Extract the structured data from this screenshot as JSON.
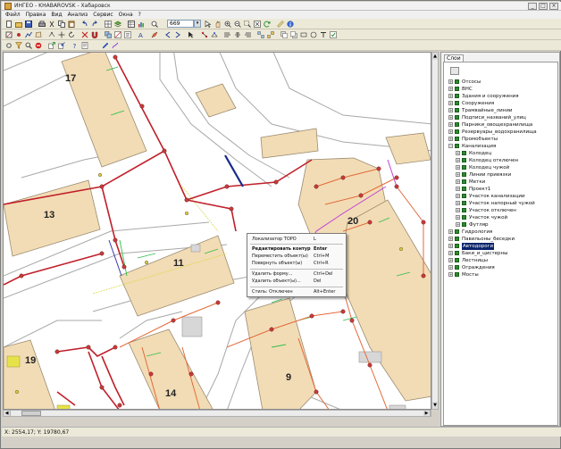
{
  "window": {
    "title": "ИНГЕО - KHABAROVSK - Хабаровск",
    "buttons": [
      "_",
      "□",
      "×"
    ]
  },
  "menu": [
    "Файл",
    "Правка",
    "Вид",
    "Анализ",
    "Сервис",
    "Окна",
    "?"
  ],
  "toolbar": {
    "scale_value": "669",
    "scale_dropdown": "▾"
  },
  "map": {
    "building_labels": [
      "17",
      "13",
      "11",
      "20",
      "19",
      "14",
      "9"
    ]
  },
  "context_menu": {
    "items": [
      {
        "label": "Локализатор ТОРО",
        "shortcut": "L"
      },
      {
        "label": "Редактировать контур",
        "shortcut": "Enter"
      },
      {
        "label": "Переместить объект(ы)",
        "shortcut": "Ctrl+M"
      },
      {
        "label": "Повернуть объект(ы)",
        "shortcut": "Ctrl+R"
      },
      {
        "label": "Удалить форму...",
        "shortcut": "Ctrl+Del"
      },
      {
        "label": "Удалить объект(ы)...",
        "shortcut": "Del"
      },
      {
        "label": "Стиль: Отключен",
        "shortcut": "Alt+Enter"
      }
    ]
  },
  "layers_panel": {
    "tab": "Слои",
    "tree": [
      {
        "label": "Отсосы",
        "level": 0,
        "expander": "+"
      },
      {
        "label": "ВНС",
        "level": 0,
        "expander": "+"
      },
      {
        "label": "Здания и сооружения",
        "level": 0,
        "expander": "+"
      },
      {
        "label": "Сооружения",
        "level": 0,
        "expander": "+"
      },
      {
        "label": "Трамвайные_линии",
        "level": 0,
        "expander": "+"
      },
      {
        "label": "Подписи_названий_улиц",
        "level": 0,
        "expander": "+"
      },
      {
        "label": "Парники_овощехранилища",
        "level": 0,
        "expander": "+"
      },
      {
        "label": "Резервуары_водохранилища",
        "level": 0,
        "expander": "+"
      },
      {
        "label": "Промобъекты",
        "level": 0,
        "expander": "+"
      },
      {
        "label": "Канализация",
        "level": 0,
        "expander": "−"
      },
      {
        "label": "Колодец",
        "level": 1,
        "expander": "+"
      },
      {
        "label": "Колодец отключен",
        "level": 1,
        "expander": "+"
      },
      {
        "label": "Колодец чужой",
        "level": 1,
        "expander": "+"
      },
      {
        "label": "Линии привязки",
        "level": 1,
        "expander": "+"
      },
      {
        "label": "Метки",
        "level": 1,
        "expander": "+"
      },
      {
        "label": "Проект1",
        "level": 1,
        "expander": "+"
      },
      {
        "label": "Участок канализации",
        "level": 1,
        "expander": "+"
      },
      {
        "label": "Участок напорный чужой",
        "level": 1,
        "expander": "+"
      },
      {
        "label": "Участок отключен",
        "level": 1,
        "expander": "+"
      },
      {
        "label": "Участок чужой",
        "level": 1,
        "expander": "+"
      },
      {
        "label": "Футляр",
        "level": 1,
        "expander": "+"
      },
      {
        "label": "Гидрология",
        "level": 0,
        "expander": "+"
      },
      {
        "label": "Павильоны_беседки",
        "level": 0,
        "expander": "+"
      },
      {
        "label": "Автодороги",
        "level": 0,
        "expander": "+",
        "selected": true
      },
      {
        "label": "Баки_и_цистерны",
        "level": 0,
        "expander": "+"
      },
      {
        "label": "Лестницы",
        "level": 0,
        "expander": "+"
      },
      {
        "label": "Ограждения",
        "level": 0,
        "expander": "+"
      },
      {
        "label": "Мосты",
        "level": 0,
        "expander": "+"
      }
    ]
  },
  "statusbar": {
    "coords": "X: 2554,17; Y: 19780,67"
  },
  "colors": {
    "building_fill": "#f2dcb5",
    "building_stroke": "#9a8b70",
    "road_line": "#a8a8a8",
    "sewer_main": "#c0202a",
    "sewer_branch": "#e36a3a",
    "pressure_line": "#c040d8",
    "link_line": "#2fbf4a",
    "selected_line": "#1a2a8a",
    "layer_check": "#2f8a2f"
  }
}
